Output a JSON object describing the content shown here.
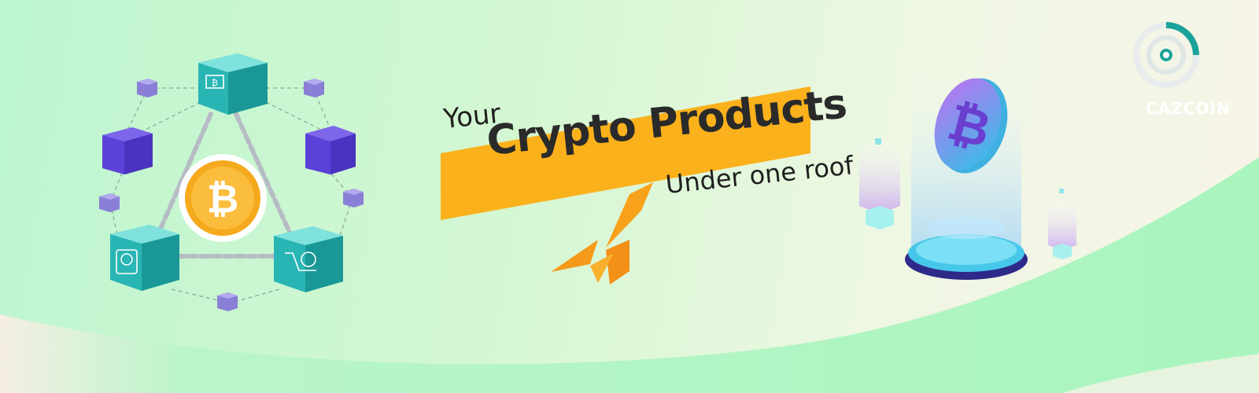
{
  "headline": {
    "line1": "Your",
    "line2": "Crypto Products",
    "line3": "Under one roof"
  },
  "brand": {
    "name": "CAZCOIN"
  },
  "icons": {
    "coin": "bitcoin-icon",
    "logo": "cazcoin-logo-icon"
  },
  "colors": {
    "banner_orange": "#fbb11c",
    "teal": "#2ab5b5",
    "purple": "#6b52e0",
    "coin_orange": "#f5a91c"
  }
}
